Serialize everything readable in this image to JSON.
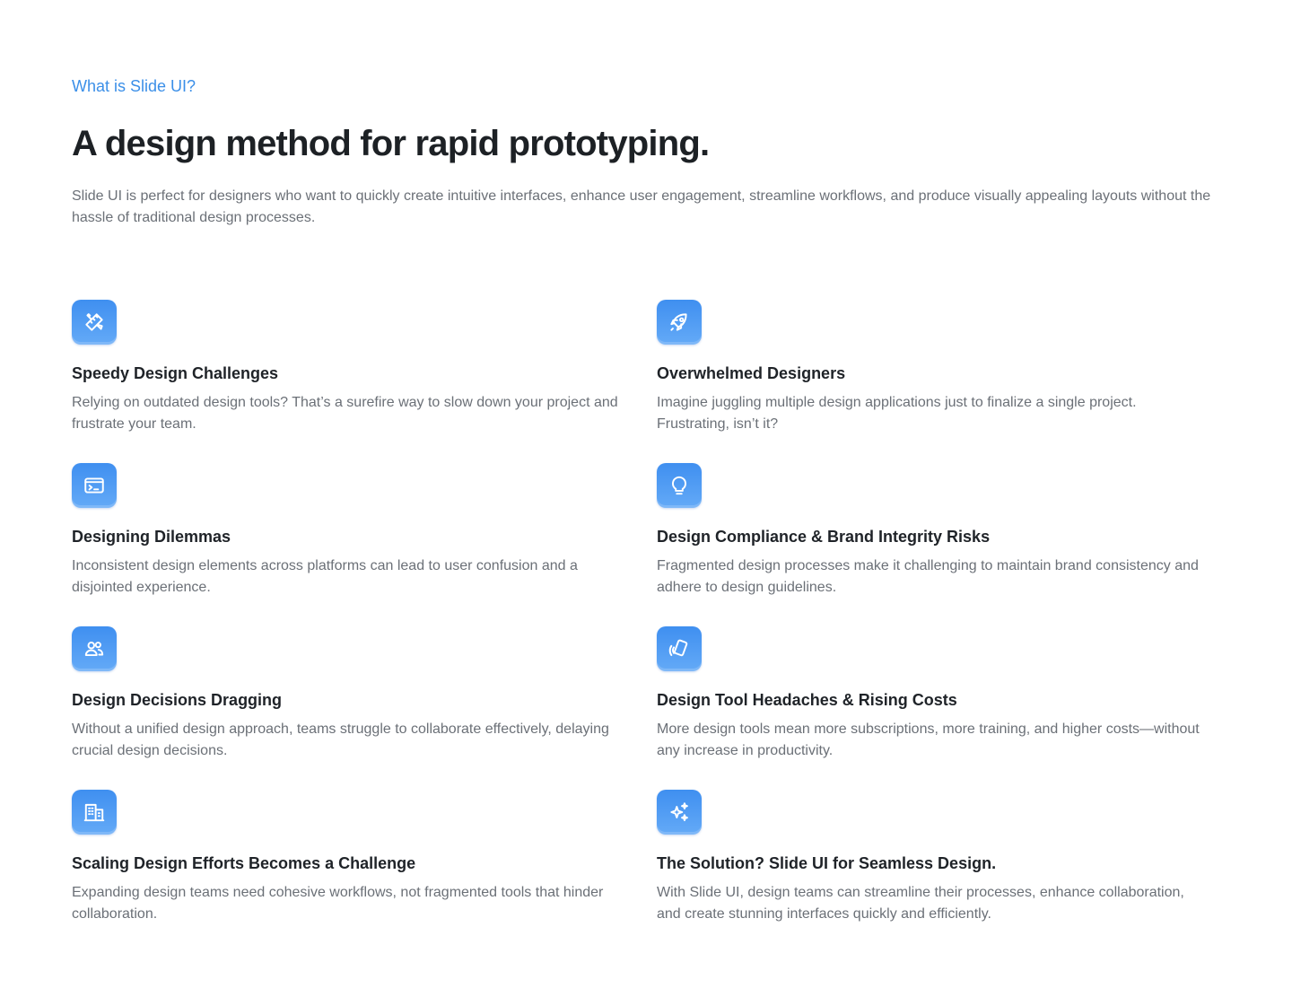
{
  "header": {
    "eyebrow": "What is Slide UI?",
    "title": "A design method for rapid prototyping.",
    "intro": "Slide UI is perfect for designers who want to quickly create intuitive interfaces, enhance user engagement, streamline workflows, and produce visually appealing layouts without the hassle of traditional design processes."
  },
  "colors": {
    "accent": "#3b8fe8",
    "heading": "#1d2125",
    "body_text": "#6b7077",
    "icon_gradient_top": "#3f8ff0",
    "icon_gradient_bottom": "#64aaf7"
  },
  "features": [
    {
      "icon": "design-tools-icon",
      "title": "Speedy Design Challenges",
      "description": "Relying on outdated design tools? That’s a surefire way to slow down your project and frustrate your team."
    },
    {
      "icon": "rocket-icon",
      "title": "Overwhelmed Designers",
      "description": " Imagine juggling multiple design applications just to finalize a single project. Frustrating, isn’t it?"
    },
    {
      "icon": "terminal-window-icon",
      "title": "Designing Dilemmas",
      "description": "Inconsistent design elements across platforms can lead to user confusion and a disjointed experience."
    },
    {
      "icon": "lightbulb-icon",
      "title": "Design Compliance & Brand Integrity Risks",
      "description": "Fragmented design processes make it challenging to maintain brand consistency and adhere to design guidelines."
    },
    {
      "icon": "team-users-icon",
      "title": "Design Decisions Dragging",
      "description": "Without a unified design approach, teams struggle to collaborate effectively, delaying crucial design decisions."
    },
    {
      "icon": "tap-card-icon",
      "title": "Design Tool Headaches & Rising Costs",
      "description": "More design tools mean more subscriptions, more training, and higher costs—without any increase in productivity."
    },
    {
      "icon": "building-icon",
      "title": "Scaling Design Efforts Becomes a Challenge",
      "description": "Expanding design teams need cohesive workflows, not fragmented tools that hinder collaboration."
    },
    {
      "icon": "sparkles-icon",
      "title": "The Solution? Slide UI for Seamless Design.",
      "description": "With Slide UI, design teams can streamline their processes, enhance collaboration, and create stunning interfaces quickly and efficiently."
    }
  ]
}
